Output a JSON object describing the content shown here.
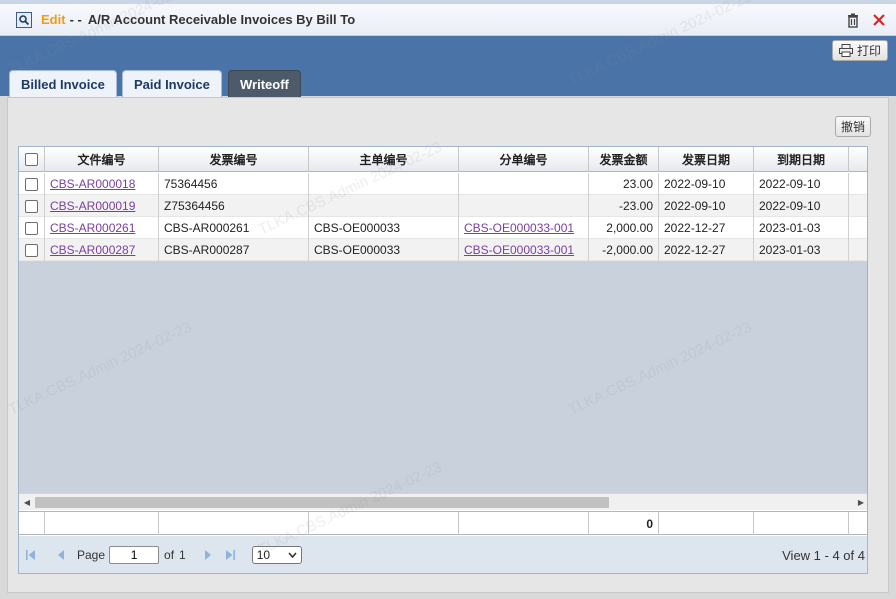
{
  "window": {
    "edit_label": "Edit",
    "separator": "- -",
    "title": "A/R Account Receivable Invoices By Bill To"
  },
  "toolbar": {
    "print_label": "打印",
    "cancel_label": "撤销"
  },
  "tabs": [
    {
      "label": "Billed Invoice",
      "active": false
    },
    {
      "label": "Paid Invoice",
      "active": false
    },
    {
      "label": "Writeoff",
      "active": true
    }
  ],
  "grid": {
    "columns": [
      "文件编号",
      "发票编号",
      "主单编号",
      "分单编号",
      "发票金额",
      "发票日期",
      "到期日期"
    ],
    "rows": [
      {
        "doc_no": "CBS-AR000018",
        "invoice_no": "75364456",
        "master_no": "",
        "house_no": "",
        "amount": "23.00",
        "invoice_date": "2022-09-10",
        "due_date": "2022-09-10"
      },
      {
        "doc_no": "CBS-AR000019",
        "invoice_no": "Z75364456",
        "master_no": "",
        "house_no": "",
        "amount": "-23.00",
        "invoice_date": "2022-09-10",
        "due_date": "2022-09-10"
      },
      {
        "doc_no": "CBS-AR000261",
        "invoice_no": "CBS-AR000261",
        "master_no": "CBS-OE000033",
        "house_no": "CBS-OE000033-001",
        "amount": "2,000.00",
        "invoice_date": "2022-12-27",
        "due_date": "2023-01-03"
      },
      {
        "doc_no": "CBS-AR000287",
        "invoice_no": "CBS-AR000287",
        "master_no": "CBS-OE000033",
        "house_no": "CBS-OE000033-001",
        "amount": "-2,000.00",
        "invoice_date": "2022-12-27",
        "due_date": "2023-01-03"
      }
    ],
    "total_amount": "0"
  },
  "pager": {
    "page_label": "Page",
    "current_page": "1",
    "of_label": "of",
    "total_pages": "1",
    "page_size": "10",
    "view_text": "View 1 - 4 of 4"
  },
  "watermark": "TLKA.CBS.Admin 2024-02-23",
  "colors": {
    "header_band": "#4a74a8",
    "link": "#7a3fa0",
    "edit_label": "#f39c12",
    "active_tab": "#4d5a6a"
  }
}
